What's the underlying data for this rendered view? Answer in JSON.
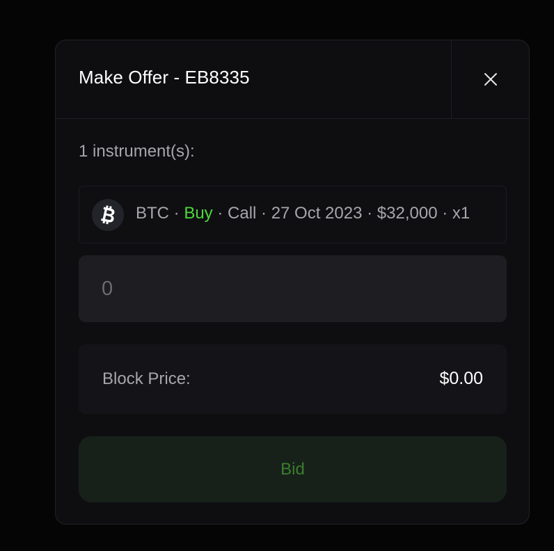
{
  "modal": {
    "title": "Make Offer - EB8335",
    "close_icon": "close-icon"
  },
  "instruments": {
    "count_label": "1 instrument(s):",
    "items": [
      {
        "icon": "bitcoin-icon",
        "asset": "BTC",
        "side": "Buy",
        "type": "Call",
        "expiry": "27 Oct 2023",
        "strike": "$32,000",
        "quantity": "x1",
        "separator": " · "
      }
    ]
  },
  "price_input": {
    "value": "",
    "placeholder": "0"
  },
  "block_price": {
    "label": "Block Price:",
    "value": "$0.00"
  },
  "bid_button": {
    "label": "Bid"
  },
  "colors": {
    "background": "#050506",
    "modal": "#0e0e11",
    "buy_green": "#4fd63c",
    "bid_text": "#3c7f2d",
    "bid_bg": "#17211a"
  }
}
